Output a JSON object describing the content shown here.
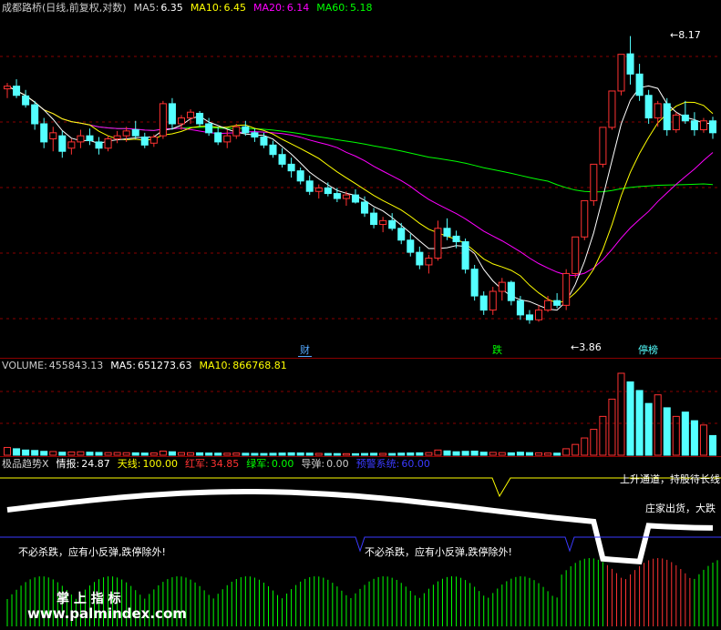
{
  "colors": {
    "up": "#ff3232",
    "down": "#54ffff",
    "ma5": "#ffffff",
    "ma10": "#ffff00",
    "ma20": "#ff00ff",
    "ma60": "#00ff00",
    "grid": "#8a0000",
    "label": "#cccccc"
  },
  "header": {
    "title": "成都路桥(日线,前复权,对数)",
    "ma5_label": "MA5:",
    "ma5_value": "6.35",
    "ma10_label": "MA10:",
    "ma10_value": "6.45",
    "ma20_label": "MA20:",
    "ma20_value": "6.14",
    "ma60_label": "MA60:",
    "ma60_value": "5.18"
  },
  "price_panel": {
    "high_label": "8.17",
    "low_label": "3.86",
    "events": [
      {
        "label": "财",
        "color": "#54a8ff"
      },
      {
        "label": "跌",
        "color": "#00ff00"
      },
      {
        "label": "停榜",
        "color": "#54ffff"
      }
    ]
  },
  "volume_panel": {
    "vol_label": "VOLUME:",
    "vol_value": "455843.13",
    "ma5_label": "MA5:",
    "ma5_value": "651273.63",
    "ma10_label": "MA10:",
    "ma10_value": "866768.81"
  },
  "indicator_panel": {
    "title": "极品趋势X",
    "qingbao_label": "情报:",
    "qingbao_value": "24.87",
    "tianxian_label": "天线:",
    "tianxian_value": "100.00",
    "hongjun_label": "红军:",
    "hongjun_value": "34.85",
    "lvjun_label": "绿军:",
    "lvjun_value": "0.00",
    "daodan_label": "导弹:",
    "daodan_value": "0.00",
    "yujing_label": "预警系统:",
    "yujing_value": "60.00",
    "annotation_1": "不必杀跌，应有小反弹,跌停除外!",
    "annotation_2": "不必杀跌，应有小反弹,跌停除外!",
    "annotation_3": "上升通道，持股待长线",
    "annotation_4": "庄家出货，大跌",
    "watermark_cn": "掌 上 指 标",
    "watermark_url": "www.palmindex.com"
  },
  "chart_data": {
    "type": "candlestick",
    "scale": "log",
    "ylim": [
      3.6,
      8.6
    ],
    "ohlc": [
      [
        7.12,
        7.23,
        6.95,
        7.17
      ],
      [
        7.17,
        7.3,
        6.95,
        7.0
      ],
      [
        6.99,
        7.1,
        6.78,
        6.83
      ],
      [
        6.83,
        6.9,
        6.4,
        6.5
      ],
      [
        6.5,
        6.6,
        6.1,
        6.2
      ],
      [
        6.25,
        6.45,
        6.05,
        6.35
      ],
      [
        6.3,
        6.38,
        5.95,
        6.05
      ],
      [
        6.1,
        6.25,
        6.0,
        6.2
      ],
      [
        6.2,
        6.4,
        6.1,
        6.3
      ],
      [
        6.3,
        6.42,
        6.15,
        6.22
      ],
      [
        6.2,
        6.28,
        6.0,
        6.1
      ],
      [
        6.1,
        6.3,
        6.05,
        6.25
      ],
      [
        6.25,
        6.38,
        6.18,
        6.3
      ],
      [
        6.3,
        6.45,
        6.2,
        6.38
      ],
      [
        6.4,
        6.55,
        6.25,
        6.3
      ],
      [
        6.28,
        6.35,
        6.1,
        6.15
      ],
      [
        6.18,
        6.32,
        6.12,
        6.28
      ],
      [
        6.3,
        6.9,
        6.25,
        6.85
      ],
      [
        6.85,
        6.95,
        6.4,
        6.5
      ],
      [
        6.5,
        6.65,
        6.4,
        6.6
      ],
      [
        6.6,
        6.75,
        6.5,
        6.7
      ],
      [
        6.68,
        6.72,
        6.45,
        6.5
      ],
      [
        6.5,
        6.6,
        6.3,
        6.35
      ],
      [
        6.35,
        6.45,
        6.15,
        6.2
      ],
      [
        6.2,
        6.4,
        6.1,
        6.3
      ],
      [
        6.3,
        6.5,
        6.25,
        6.45
      ],
      [
        6.45,
        6.55,
        6.3,
        6.35
      ],
      [
        6.35,
        6.42,
        6.2,
        6.28
      ],
      [
        6.28,
        6.35,
        6.1,
        6.15
      ],
      [
        6.15,
        6.22,
        5.95,
        6.0
      ],
      [
        6.0,
        6.1,
        5.8,
        5.85
      ],
      [
        5.85,
        5.95,
        5.65,
        5.75
      ],
      [
        5.75,
        5.8,
        5.55,
        5.6
      ],
      [
        5.6,
        5.68,
        5.4,
        5.45
      ],
      [
        5.45,
        5.55,
        5.35,
        5.5
      ],
      [
        5.5,
        5.58,
        5.38,
        5.42
      ],
      [
        5.42,
        5.5,
        5.3,
        5.35
      ],
      [
        5.35,
        5.45,
        5.25,
        5.4
      ],
      [
        5.4,
        5.48,
        5.28,
        5.3
      ],
      [
        5.3,
        5.38,
        5.1,
        5.15
      ],
      [
        5.15,
        5.22,
        4.95,
        5.0
      ],
      [
        5.0,
        5.1,
        4.9,
        5.05
      ],
      [
        5.05,
        5.15,
        4.92,
        4.95
      ],
      [
        4.95,
        5.02,
        4.75,
        4.8
      ],
      [
        4.8,
        4.88,
        4.6,
        4.65
      ],
      [
        4.65,
        4.72,
        4.45,
        4.5
      ],
      [
        4.5,
        4.62,
        4.4,
        4.58
      ],
      [
        4.58,
        5.05,
        4.55,
        4.95
      ],
      [
        4.95,
        5.08,
        4.8,
        4.85
      ],
      [
        4.85,
        4.92,
        4.7,
        4.78
      ],
      [
        4.78,
        4.82,
        4.4,
        4.45
      ],
      [
        4.45,
        4.5,
        4.1,
        4.15
      ],
      [
        4.15,
        4.2,
        3.95,
        4.0
      ],
      [
        4.0,
        4.25,
        3.95,
        4.2
      ],
      [
        4.2,
        4.35,
        4.1,
        4.3
      ],
      [
        4.3,
        4.32,
        4.05,
        4.1
      ],
      [
        4.1,
        4.15,
        3.9,
        3.95
      ],
      [
        3.95,
        4.0,
        3.86,
        3.9
      ],
      [
        3.9,
        4.05,
        3.88,
        4.0
      ],
      [
        4.0,
        4.15,
        3.98,
        4.1
      ],
      [
        4.1,
        4.18,
        4.02,
        4.05
      ],
      [
        4.05,
        4.45,
        4.0,
        4.4
      ],
      [
        4.4,
        4.84,
        4.35,
        4.84
      ],
      [
        4.84,
        5.32,
        4.8,
        5.32
      ],
      [
        5.32,
        5.85,
        5.25,
        5.85
      ],
      [
        5.85,
        6.44,
        5.8,
        6.44
      ],
      [
        6.44,
        7.08,
        6.4,
        7.08
      ],
      [
        7.08,
        7.79,
        7.0,
        7.79
      ],
      [
        7.8,
        8.17,
        7.2,
        7.4
      ],
      [
        7.4,
        7.6,
        6.9,
        7.0
      ],
      [
        7.0,
        7.1,
        6.5,
        6.6
      ],
      [
        6.6,
        6.9,
        6.45,
        6.85
      ],
      [
        6.85,
        6.95,
        6.3,
        6.4
      ],
      [
        6.4,
        6.7,
        6.35,
        6.65
      ],
      [
        6.65,
        6.9,
        6.5,
        6.55
      ],
      [
        6.55,
        6.7,
        6.3,
        6.4
      ],
      [
        6.4,
        6.6,
        6.35,
        6.55
      ],
      [
        6.55,
        6.62,
        6.25,
        6.35
      ]
    ],
    "volume": [
      180000,
      150000,
      120000,
      110000,
      90000,
      85000,
      70000,
      75000,
      80000,
      70000,
      65000,
      60000,
      62000,
      58000,
      55000,
      50000,
      52000,
      95000,
      80000,
      60000,
      58000,
      55000,
      50000,
      48000,
      46000,
      50000,
      45000,
      42000,
      40000,
      45000,
      50000,
      55000,
      52000,
      48000,
      42000,
      40000,
      38000,
      36000,
      35000,
      40000,
      45000,
      42000,
      40000,
      48000,
      52000,
      55000,
      60000,
      120000,
      100000,
      80000,
      90000,
      95000,
      70000,
      65000,
      60000,
      55000,
      70000,
      60000,
      55000,
      50000,
      48000,
      150000,
      250000,
      400000,
      600000,
      900000,
      1300000,
      1900000,
      1700000,
      1500000,
      1200000,
      1400000,
      1100000,
      900000,
      1000000,
      800000,
      700000,
      455843
    ]
  }
}
